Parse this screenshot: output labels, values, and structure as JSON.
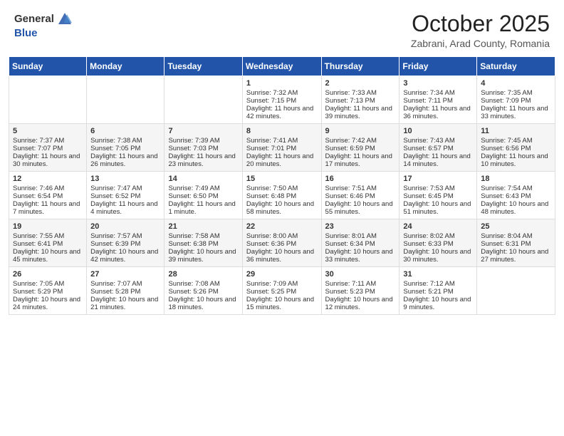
{
  "header": {
    "logo_general": "General",
    "logo_blue": "Blue",
    "month_title": "October 2025",
    "subtitle": "Zabrani, Arad County, Romania"
  },
  "weekdays": [
    "Sunday",
    "Monday",
    "Tuesday",
    "Wednesday",
    "Thursday",
    "Friday",
    "Saturday"
  ],
  "weeks": [
    [
      {
        "day": "",
        "sunrise": "",
        "sunset": "",
        "daylight": ""
      },
      {
        "day": "",
        "sunrise": "",
        "sunset": "",
        "daylight": ""
      },
      {
        "day": "",
        "sunrise": "",
        "sunset": "",
        "daylight": ""
      },
      {
        "day": "1",
        "sunrise": "Sunrise: 7:32 AM",
        "sunset": "Sunset: 7:15 PM",
        "daylight": "Daylight: 11 hours and 42 minutes."
      },
      {
        "day": "2",
        "sunrise": "Sunrise: 7:33 AM",
        "sunset": "Sunset: 7:13 PM",
        "daylight": "Daylight: 11 hours and 39 minutes."
      },
      {
        "day": "3",
        "sunrise": "Sunrise: 7:34 AM",
        "sunset": "Sunset: 7:11 PM",
        "daylight": "Daylight: 11 hours and 36 minutes."
      },
      {
        "day": "4",
        "sunrise": "Sunrise: 7:35 AM",
        "sunset": "Sunset: 7:09 PM",
        "daylight": "Daylight: 11 hours and 33 minutes."
      }
    ],
    [
      {
        "day": "5",
        "sunrise": "Sunrise: 7:37 AM",
        "sunset": "Sunset: 7:07 PM",
        "daylight": "Daylight: 11 hours and 30 minutes."
      },
      {
        "day": "6",
        "sunrise": "Sunrise: 7:38 AM",
        "sunset": "Sunset: 7:05 PM",
        "daylight": "Daylight: 11 hours and 26 minutes."
      },
      {
        "day": "7",
        "sunrise": "Sunrise: 7:39 AM",
        "sunset": "Sunset: 7:03 PM",
        "daylight": "Daylight: 11 hours and 23 minutes."
      },
      {
        "day": "8",
        "sunrise": "Sunrise: 7:41 AM",
        "sunset": "Sunset: 7:01 PM",
        "daylight": "Daylight: 11 hours and 20 minutes."
      },
      {
        "day": "9",
        "sunrise": "Sunrise: 7:42 AM",
        "sunset": "Sunset: 6:59 PM",
        "daylight": "Daylight: 11 hours and 17 minutes."
      },
      {
        "day": "10",
        "sunrise": "Sunrise: 7:43 AM",
        "sunset": "Sunset: 6:57 PM",
        "daylight": "Daylight: 11 hours and 14 minutes."
      },
      {
        "day": "11",
        "sunrise": "Sunrise: 7:45 AM",
        "sunset": "Sunset: 6:56 PM",
        "daylight": "Daylight: 11 hours and 10 minutes."
      }
    ],
    [
      {
        "day": "12",
        "sunrise": "Sunrise: 7:46 AM",
        "sunset": "Sunset: 6:54 PM",
        "daylight": "Daylight: 11 hours and 7 minutes."
      },
      {
        "day": "13",
        "sunrise": "Sunrise: 7:47 AM",
        "sunset": "Sunset: 6:52 PM",
        "daylight": "Daylight: 11 hours and 4 minutes."
      },
      {
        "day": "14",
        "sunrise": "Sunrise: 7:49 AM",
        "sunset": "Sunset: 6:50 PM",
        "daylight": "Daylight: 11 hours and 1 minute."
      },
      {
        "day": "15",
        "sunrise": "Sunrise: 7:50 AM",
        "sunset": "Sunset: 6:48 PM",
        "daylight": "Daylight: 10 hours and 58 minutes."
      },
      {
        "day": "16",
        "sunrise": "Sunrise: 7:51 AM",
        "sunset": "Sunset: 6:46 PM",
        "daylight": "Daylight: 10 hours and 55 minutes."
      },
      {
        "day": "17",
        "sunrise": "Sunrise: 7:53 AM",
        "sunset": "Sunset: 6:45 PM",
        "daylight": "Daylight: 10 hours and 51 minutes."
      },
      {
        "day": "18",
        "sunrise": "Sunrise: 7:54 AM",
        "sunset": "Sunset: 6:43 PM",
        "daylight": "Daylight: 10 hours and 48 minutes."
      }
    ],
    [
      {
        "day": "19",
        "sunrise": "Sunrise: 7:55 AM",
        "sunset": "Sunset: 6:41 PM",
        "daylight": "Daylight: 10 hours and 45 minutes."
      },
      {
        "day": "20",
        "sunrise": "Sunrise: 7:57 AM",
        "sunset": "Sunset: 6:39 PM",
        "daylight": "Daylight: 10 hours and 42 minutes."
      },
      {
        "day": "21",
        "sunrise": "Sunrise: 7:58 AM",
        "sunset": "Sunset: 6:38 PM",
        "daylight": "Daylight: 10 hours and 39 minutes."
      },
      {
        "day": "22",
        "sunrise": "Sunrise: 8:00 AM",
        "sunset": "Sunset: 6:36 PM",
        "daylight": "Daylight: 10 hours and 36 minutes."
      },
      {
        "day": "23",
        "sunrise": "Sunrise: 8:01 AM",
        "sunset": "Sunset: 6:34 PM",
        "daylight": "Daylight: 10 hours and 33 minutes."
      },
      {
        "day": "24",
        "sunrise": "Sunrise: 8:02 AM",
        "sunset": "Sunset: 6:33 PM",
        "daylight": "Daylight: 10 hours and 30 minutes."
      },
      {
        "day": "25",
        "sunrise": "Sunrise: 8:04 AM",
        "sunset": "Sunset: 6:31 PM",
        "daylight": "Daylight: 10 hours and 27 minutes."
      }
    ],
    [
      {
        "day": "26",
        "sunrise": "Sunrise: 7:05 AM",
        "sunset": "Sunset: 5:29 PM",
        "daylight": "Daylight: 10 hours and 24 minutes."
      },
      {
        "day": "27",
        "sunrise": "Sunrise: 7:07 AM",
        "sunset": "Sunset: 5:28 PM",
        "daylight": "Daylight: 10 hours and 21 minutes."
      },
      {
        "day": "28",
        "sunrise": "Sunrise: 7:08 AM",
        "sunset": "Sunset: 5:26 PM",
        "daylight": "Daylight: 10 hours and 18 minutes."
      },
      {
        "day": "29",
        "sunrise": "Sunrise: 7:09 AM",
        "sunset": "Sunset: 5:25 PM",
        "daylight": "Daylight: 10 hours and 15 minutes."
      },
      {
        "day": "30",
        "sunrise": "Sunrise: 7:11 AM",
        "sunset": "Sunset: 5:23 PM",
        "daylight": "Daylight: 10 hours and 12 minutes."
      },
      {
        "day": "31",
        "sunrise": "Sunrise: 7:12 AM",
        "sunset": "Sunset: 5:21 PM",
        "daylight": "Daylight: 10 hours and 9 minutes."
      },
      {
        "day": "",
        "sunrise": "",
        "sunset": "",
        "daylight": ""
      }
    ]
  ]
}
